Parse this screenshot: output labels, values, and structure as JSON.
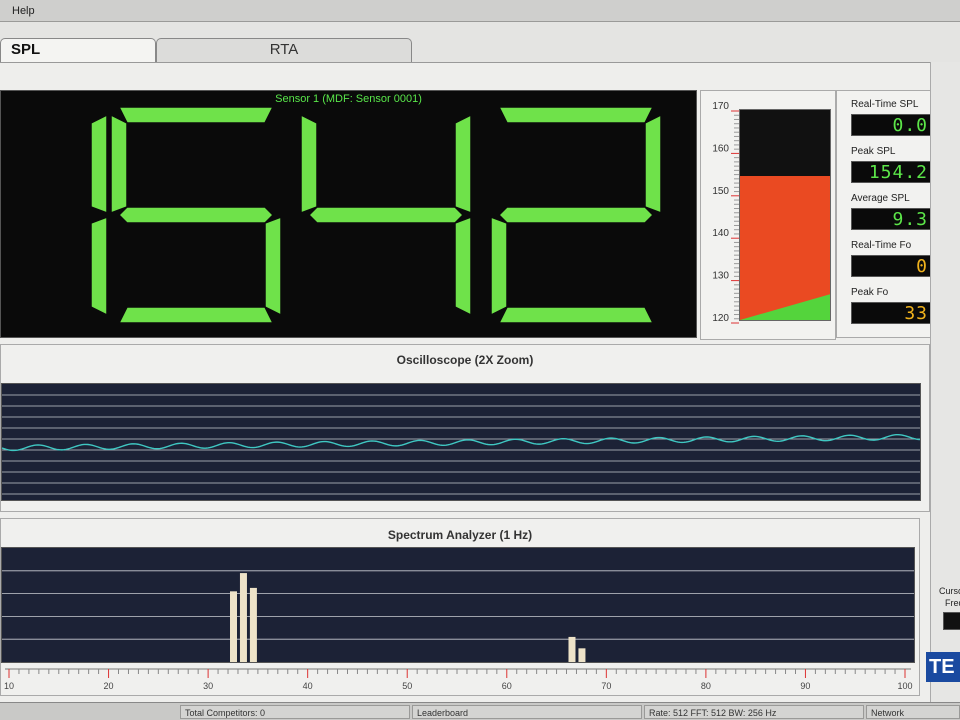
{
  "menu": {
    "help": "Help"
  },
  "tabs": [
    {
      "label": "SPL",
      "active": true
    },
    {
      "label": "RTA",
      "active": false
    }
  ],
  "display": {
    "sensor_label": "Sensor 1 (MDF: Sensor 0001)",
    "digits": [
      "1",
      "5",
      "4",
      "2"
    ],
    "value": 154.2,
    "segment_color": "#6fe24a"
  },
  "gauge": {
    "ticks": [
      "170",
      "160",
      "150",
      "140",
      "130",
      "120"
    ],
    "min": 120,
    "max": 170,
    "level": 154.2,
    "red_color": "#ea4a22",
    "green_color": "#54d43c"
  },
  "readouts": [
    {
      "label": "Real-Time SPL",
      "value": "0.0",
      "color": "green"
    },
    {
      "label": "Peak SPL",
      "value": "154.2",
      "color": "green"
    },
    {
      "label": "Average SPL",
      "value": "9.3",
      "color": "green"
    },
    {
      "label": "Real-Time Fo",
      "value": "0",
      "color": "amber"
    },
    {
      "label": "Peak Fo",
      "value": "33",
      "color": "amber"
    }
  ],
  "oscilloscope": {
    "title": "Oscilloscope (2X Zoom)",
    "trace_color": "#3fc7c2"
  },
  "spectrum": {
    "title": "Spectrum Analyzer (1 Hz)",
    "axis_ticks": [
      "10",
      "20",
      "30",
      "40",
      "50",
      "60",
      "70",
      "80",
      "90",
      "100"
    ],
    "axis_min": 10,
    "axis_max": 100,
    "bars": [
      {
        "x": 32.5,
        "level": 0.62
      },
      {
        "x": 33.5,
        "level": 0.78
      },
      {
        "x": 34.5,
        "level": 0.65
      },
      {
        "x": 66.5,
        "level": 0.22
      },
      {
        "x": 67.5,
        "level": 0.12
      }
    ],
    "bar_color": "#eee3c8"
  },
  "status": [
    {
      "text": "Total Competitors: 0"
    },
    {
      "text": "Leaderboard"
    },
    {
      "text": "Rate: 512  FFT: 512  BW: 256 Hz"
    },
    {
      "text": "Network"
    }
  ],
  "right_panel": {
    "cursor_label": "Curso",
    "freq_label": "Freq",
    "brand": "TE"
  }
}
